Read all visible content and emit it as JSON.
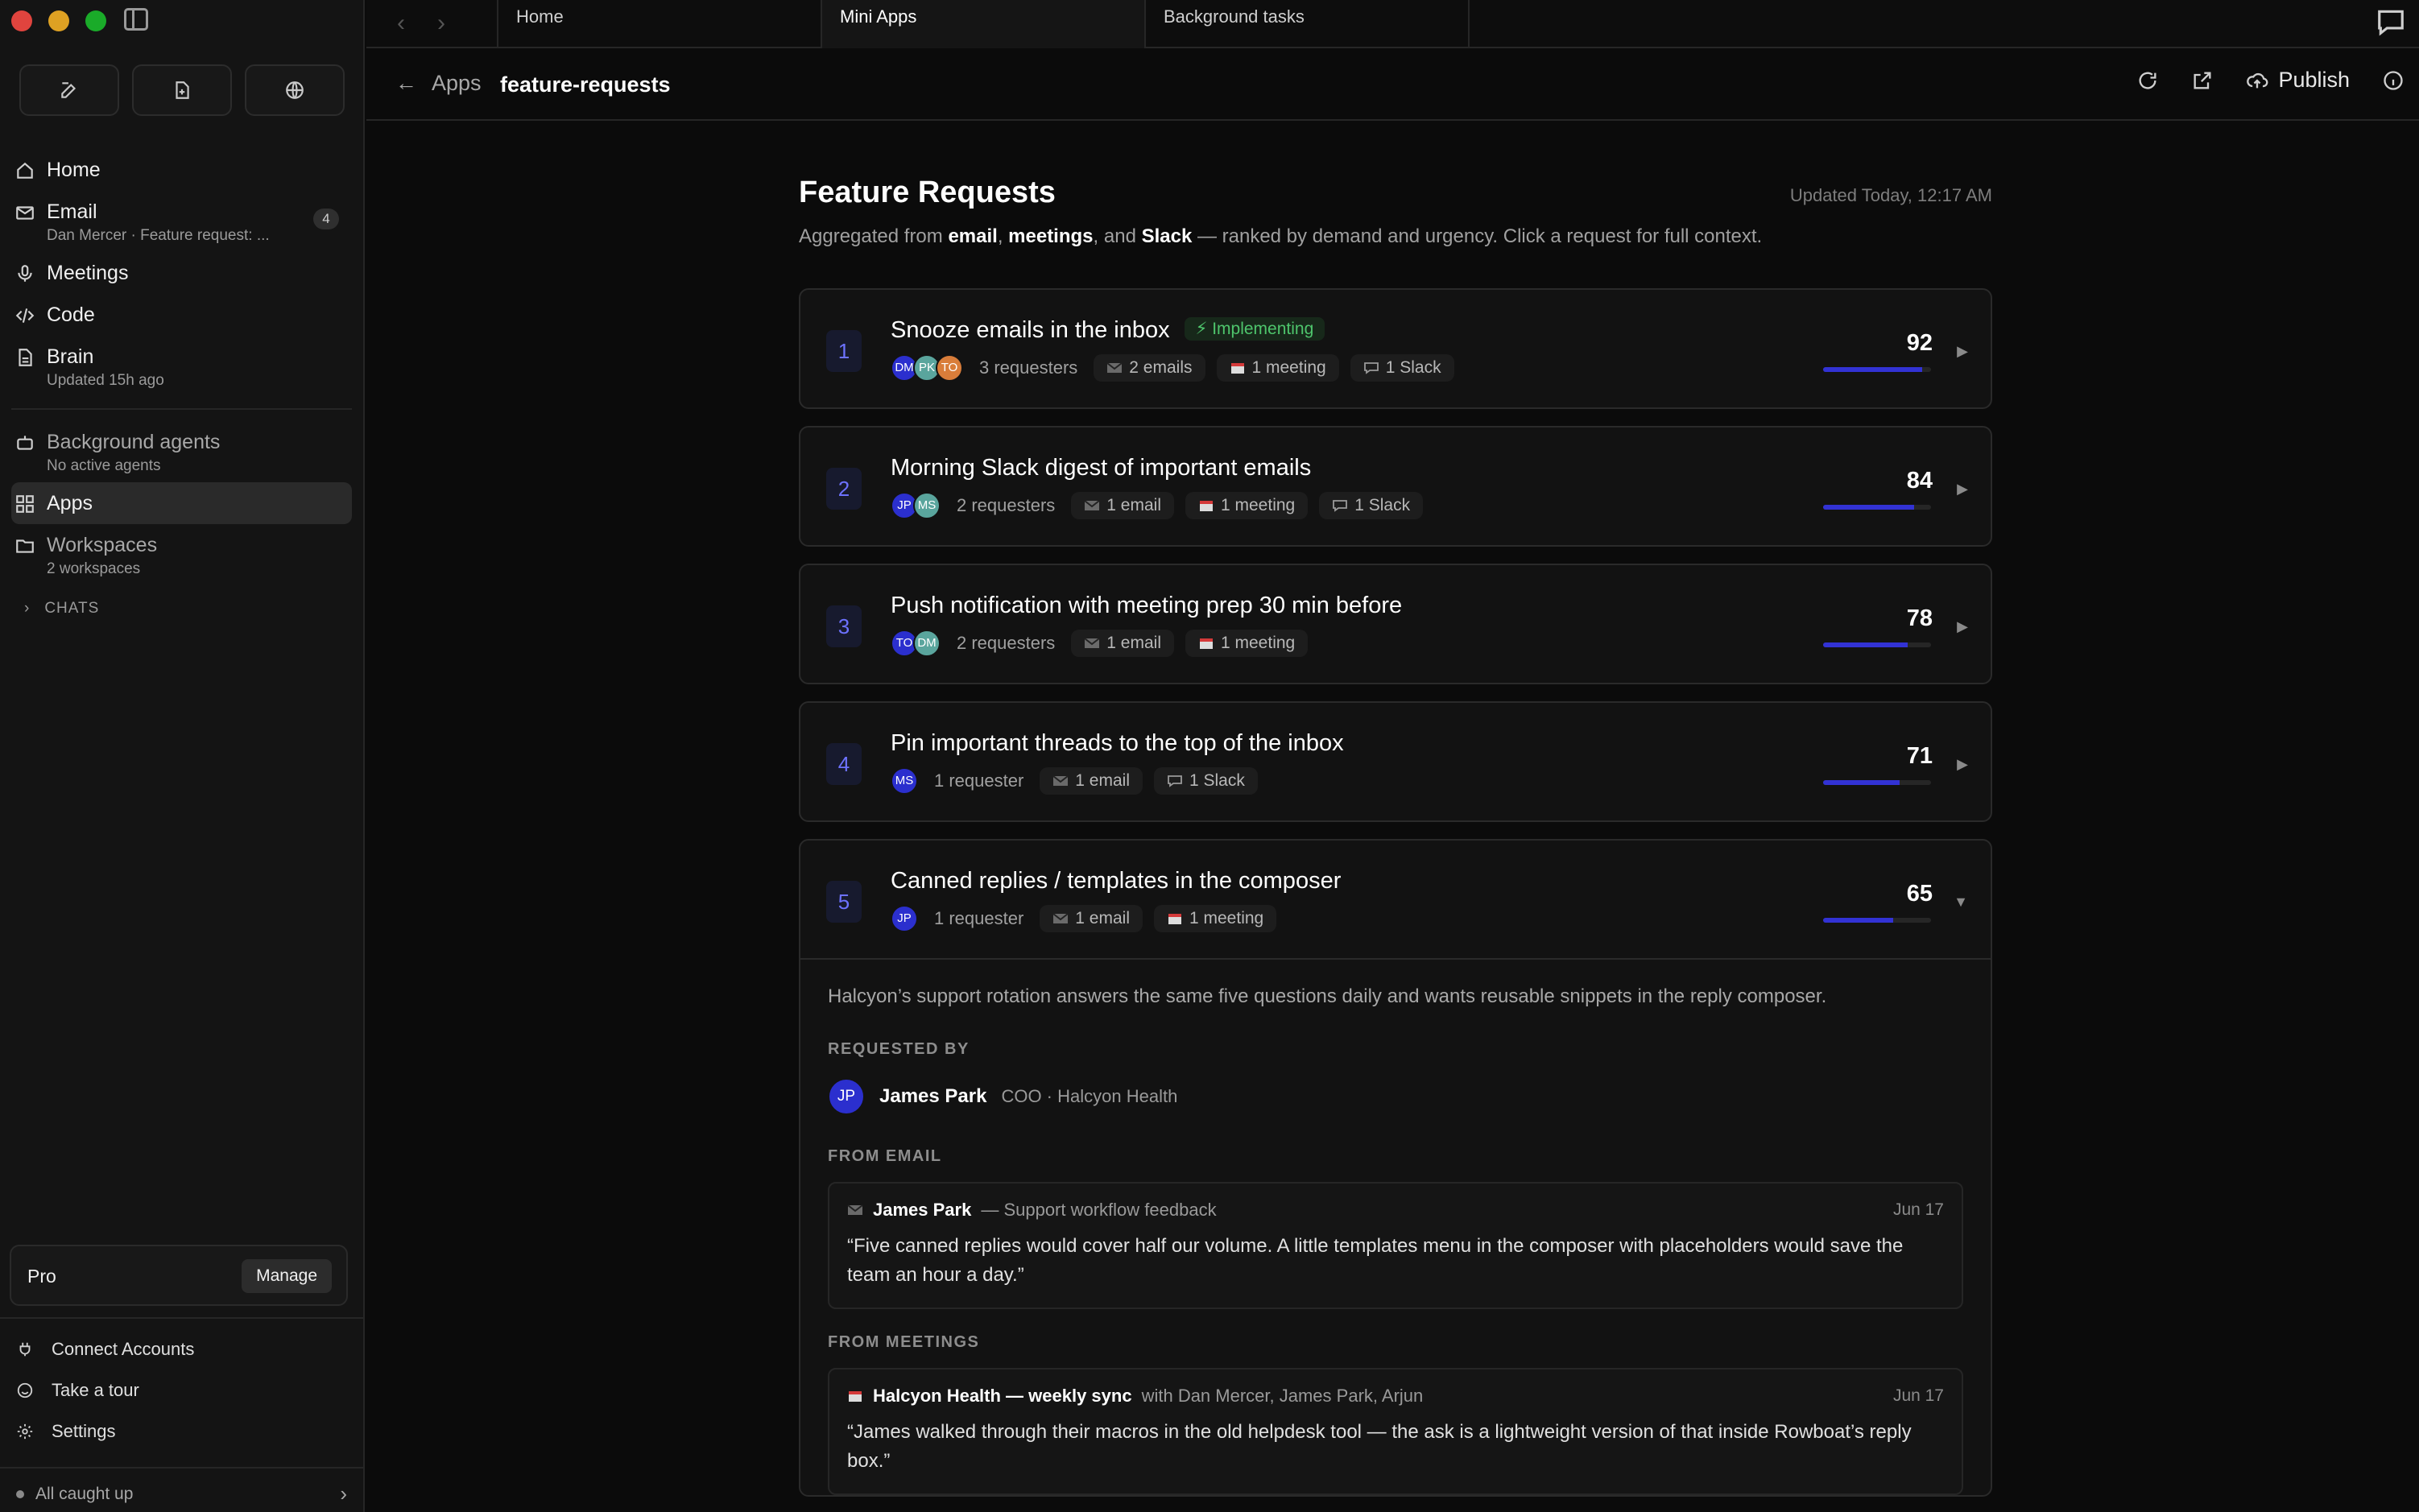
{
  "tabs": [
    "Home",
    "Mini Apps",
    "Background tasks"
  ],
  "sidebar": {
    "nav": [
      {
        "label": "Home"
      },
      {
        "label": "Email",
        "sub": "Dan Mercer · Feature request: ...",
        "badge": "4"
      },
      {
        "label": "Meetings"
      },
      {
        "label": "Code"
      },
      {
        "label": "Brain",
        "sub": "Updated 15h ago"
      }
    ],
    "nav2": [
      {
        "label": "Background agents",
        "sub": "No active agents"
      },
      {
        "label": "Apps"
      },
      {
        "label": "Workspaces",
        "sub": "2 workspaces"
      }
    ],
    "chats_label": "CHATS",
    "plan": "Pro",
    "manage": "Manage",
    "bottom_links": [
      "Connect Accounts",
      "Take a tour",
      "Settings"
    ],
    "status": "All caught up"
  },
  "appbar": {
    "back": "Apps",
    "title": "feature-requests",
    "publish": "Publish"
  },
  "page": {
    "title": "Feature Requests",
    "updated": "Updated Today, 12:17 AM",
    "subtitle_parts": [
      "Aggregated from ",
      "email",
      ", ",
      "meetings",
      ", and ",
      "Slack",
      " — ranked by demand and urgency. Click a request for full context."
    ]
  },
  "requests": [
    {
      "rank": "1",
      "title": "Snooze emails in the inbox",
      "badge": "⚡ Implementing",
      "avatars": [
        {
          "i": "DM",
          "c": "blue"
        },
        {
          "i": "PK",
          "c": "teal"
        },
        {
          "i": "TO",
          "c": "orange"
        }
      ],
      "requesters": "3 requesters",
      "email": "2 emails",
      "meeting": "1 meeting",
      "slack": "1 Slack",
      "score": "92",
      "score_fill": 0.92
    },
    {
      "rank": "2",
      "title": "Morning Slack digest of important emails",
      "avatars": [
        {
          "i": "JP",
          "c": "blue"
        },
        {
          "i": "MS",
          "c": "teal"
        }
      ],
      "requesters": "2 requesters",
      "email": "1 email",
      "meeting": "1 meeting",
      "slack": "1 Slack",
      "score": "84",
      "score_fill": 0.84
    },
    {
      "rank": "3",
      "title": "Push notification with meeting prep 30 min before",
      "avatars": [
        {
          "i": "TO",
          "c": "blue"
        },
        {
          "i": "DM",
          "c": "teal"
        }
      ],
      "requesters": "2 requesters",
      "email": "1 email",
      "meeting": "1 meeting",
      "score": "78",
      "score_fill": 0.78
    },
    {
      "rank": "4",
      "title": "Pin important threads to the top of the inbox",
      "avatars": [
        {
          "i": "MS",
          "c": "blue"
        }
      ],
      "requesters": "1 requester",
      "email": "1 email",
      "slack": "1 Slack",
      "score": "71",
      "score_fill": 0.71
    }
  ],
  "expanded": {
    "rank": "5",
    "title": "Canned replies / templates in the composer",
    "avatar": "JP",
    "requesters": "1 requester",
    "email": "1 email",
    "meeting": "1 meeting",
    "score": "65",
    "score_fill": 0.65,
    "description": "Halcyon’s support rotation answers the same five questions daily and wants reusable snippets in the reply composer.",
    "requested_by_label": "REQUESTED BY",
    "person": {
      "initials": "JP",
      "name": "James Park",
      "role": "COO · Halcyon Health"
    },
    "from_email_label": "FROM EMAIL",
    "email_src": {
      "name": "James Park",
      "ctx": "— Support workflow feedback",
      "date": "Jun 17",
      "quote": "“Five canned replies would cover half our volume. A little templates menu in the composer with placeholders would save the team an hour a day.”"
    },
    "from_meetings_label": "FROM MEETINGS",
    "meeting_src": {
      "name": "Halcyon Health — weekly sync",
      "ctx": "with Dan Mercer, James Park, Arjun",
      "date": "Jun 17",
      "quote": "“James walked through their macros in the old helpdesk tool — the ask is a lightweight version of that inside Rowboat’s reply box.”"
    }
  }
}
